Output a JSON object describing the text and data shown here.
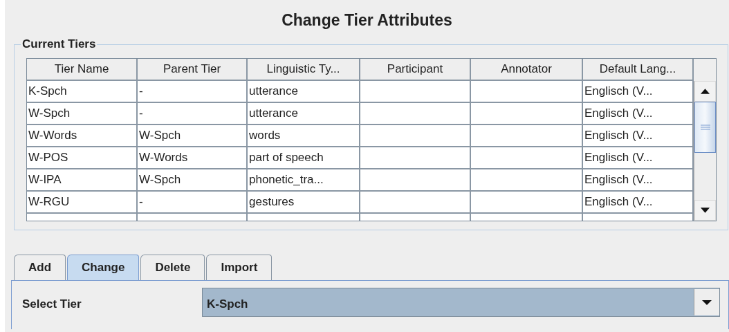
{
  "window": {
    "title": "Change Tier Attributes"
  },
  "current_tiers": {
    "title": "Current Tiers",
    "columns": [
      "Tier Name",
      "Parent Tier",
      "Linguistic Ty...",
      "Participant",
      "Annotator",
      "Default Lang..."
    ],
    "rows": [
      [
        "K-Spch",
        "-",
        "utterance",
        "",
        "",
        "Englisch (V..."
      ],
      [
        "W-Spch",
        "-",
        "utterance",
        "",
        "",
        "Englisch (V..."
      ],
      [
        "W-Words",
        "W-Spch",
        "words",
        "",
        "",
        "Englisch (V..."
      ],
      [
        "W-POS",
        "W-Words",
        "part of speech",
        "",
        "",
        "Englisch (V..."
      ],
      [
        "W-IPA",
        "W-Spch",
        "phonetic_tra...",
        "",
        "",
        "Englisch (V..."
      ],
      [
        "W-RGU",
        "-",
        "gestures",
        "",
        "",
        "Englisch (V..."
      ]
    ]
  },
  "tabs": [
    {
      "label": "Add",
      "selected": false
    },
    {
      "label": "Change",
      "selected": true
    },
    {
      "label": "Delete",
      "selected": false
    },
    {
      "label": "Import",
      "selected": false
    }
  ],
  "select_tier": {
    "label": "Select Tier",
    "value": "K-Spch"
  }
}
